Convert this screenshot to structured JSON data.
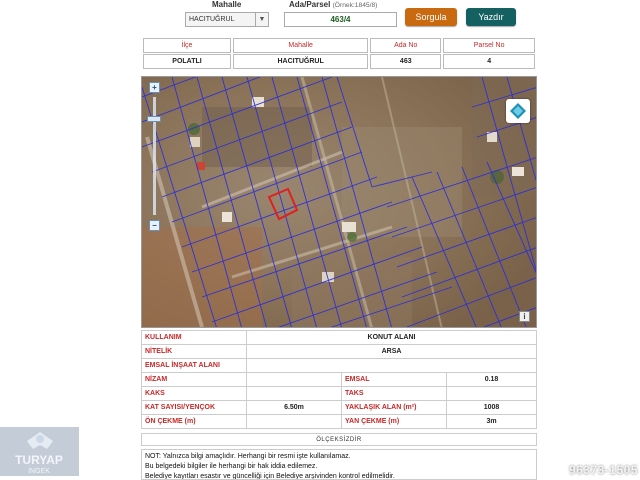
{
  "header": {
    "mahalle_label": "Mahalle",
    "ada_parsel_label": "Ada/Parsel",
    "ada_parsel_hint": "(Örnek:1845/8)",
    "mahalle_selected": "HACITUĞRUL",
    "ada_parsel_value": "463/4",
    "sorgula_label": "Sorgula",
    "yazdir_label": "Yazdır"
  },
  "summary": {
    "headers": [
      "İlçe",
      "Mahalle",
      "Ada No",
      "Parsel No"
    ],
    "values": [
      "POLATLI",
      "HACITUĞRUL",
      "463",
      "4"
    ]
  },
  "map": {
    "zoom_in": "+",
    "zoom_out": "−",
    "info": "i",
    "parcel_color": "#e02020",
    "grid_color": "#2a2fd6"
  },
  "attributes": {
    "kullanim_label": "KULLANIM",
    "kullanim_value": "KONUT ALANI",
    "nitelik_label": "NİTELİK",
    "nitelik_value": "ARSA",
    "emsal_insaat_label": "EMSAL İNŞAAT ALANI",
    "nizam_label": "NİZAM",
    "emsal_label": "EMSAL",
    "emsal_value": "0.18",
    "kaks_label": "KAKS",
    "taks_label": "TAKS",
    "kat_label": "KAT SAYISI/YENÇOK",
    "kat_value": "6.50m",
    "alan_label": "YAKLAŞIK ALAN (m²)",
    "alan_value": "1008",
    "on_cekme_label": "ÖN ÇEKME (m)",
    "yan_cekme_label": "YAN ÇEKME (m)",
    "yan_cekme_value": "3m"
  },
  "scale_label": "ÖLÇEKSİZDİR",
  "notes": [
    "NOT: Yalnızca bilgi amaçlıdır. Herhangi bir resmi işte kullanılamaz.",
    "Bu belgedeki bilgiler ile herhangi bir hak iddia edilemez.",
    "Belediye kayıtları esastır ve güncelliği için Belediye arşivinden kontrol edilmelidir."
  ],
  "watermark": {
    "brand": "TURYAP",
    "sub": "İNGEK",
    "listing_id": "96373-1505"
  }
}
